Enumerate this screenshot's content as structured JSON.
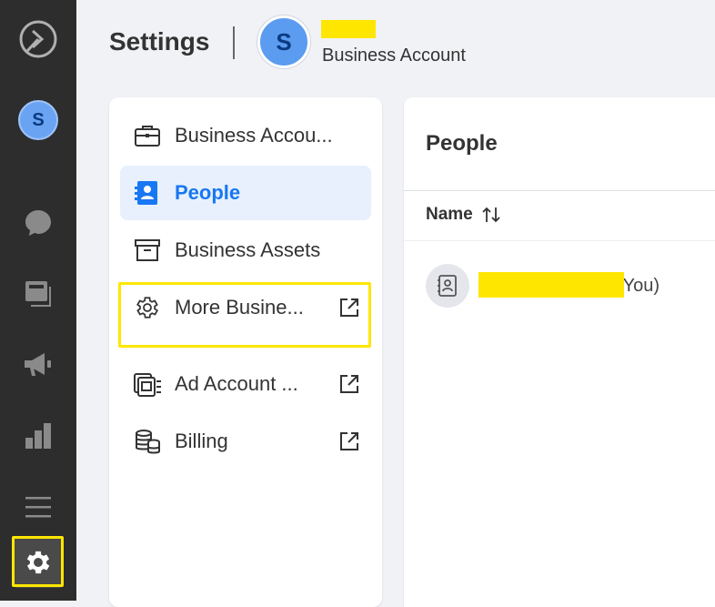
{
  "rail": {
    "avatar_letter": "S",
    "icons": [
      "logo-icon",
      "chat-icon",
      "pages-icon",
      "megaphone-icon",
      "bar-chart-icon",
      "menu-icon",
      "gear-icon"
    ]
  },
  "header": {
    "title": "Settings",
    "avatar_letter": "S",
    "subtitle": "Business Account"
  },
  "nav": {
    "items": [
      {
        "label": "Business Accou...",
        "icon": "briefcase-icon",
        "active": false,
        "external": false
      },
      {
        "label": "People",
        "icon": "people-badge-icon",
        "active": true,
        "external": false
      },
      {
        "label": "Business Assets",
        "icon": "archive-box-icon",
        "active": false,
        "external": false
      },
      {
        "label": "More Busine...",
        "icon": "gear-icon",
        "active": false,
        "external": true
      },
      {
        "label": "Ad Account ...",
        "icon": "ad-account-icon",
        "active": false,
        "external": true
      },
      {
        "label": "Billing",
        "icon": "coins-icon",
        "active": false,
        "external": true
      }
    ]
  },
  "people": {
    "title": "People",
    "column_name": "Name",
    "rows": [
      {
        "suffix": "(You)"
      }
    ]
  },
  "colors": {
    "accent": "#1877f2",
    "active_bg": "#e7f0fc",
    "rail_bg": "#2d2d2d",
    "highlight": "#ffe600"
  }
}
